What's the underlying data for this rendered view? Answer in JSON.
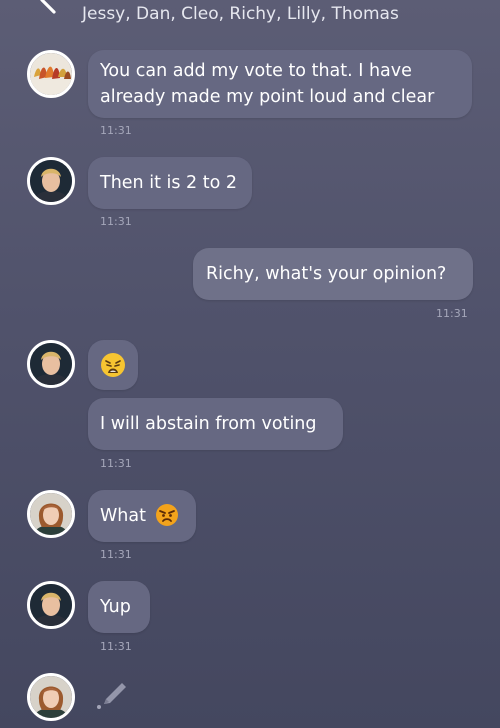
{
  "header": {
    "title": "Jessy, Dan, Cleo, Richy, Lilly, Thomas",
    "back_icon": "chevron-left-icon"
  },
  "messages": [
    {
      "sender_avatar": "autumn-leaves-avatar",
      "text_line1": "You can add my vote to that. I have",
      "text_line2": "already made my point loud and clear",
      "time": "11:31"
    },
    {
      "sender_avatar": "blond-man-avatar",
      "text": "Then it is 2 to 2",
      "time": "11:31"
    },
    {
      "direction": "outgoing",
      "text": "Richy, what's your opinion?",
      "time": "11:31"
    },
    {
      "sender_avatar": "blond-man-avatar",
      "emoji": "weary-face-emoji",
      "text": "I will abstain from voting",
      "time": "11:31"
    },
    {
      "sender_avatar": "red-haired-woman-avatar",
      "text": "What",
      "emoji": "angry-face-emoji",
      "time": "11:31"
    },
    {
      "sender_avatar": "blond-man-avatar",
      "text": "Yup",
      "time": "11:31"
    }
  ],
  "typing": {
    "avatar": "red-haired-woman-avatar",
    "icon": "pencil-icon"
  },
  "colors": {
    "bubble": "#666882",
    "bubble_outgoing": "#6f7189",
    "timestamp": "#a5a7ba",
    "background_top": "#5c5d75",
    "background_bottom": "#44475f"
  }
}
